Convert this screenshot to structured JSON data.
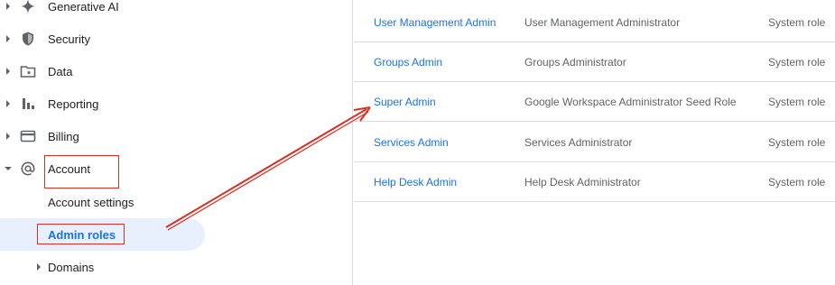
{
  "sidebar": {
    "items": [
      {
        "label": "Generative AI",
        "icon": "sparkle-icon"
      },
      {
        "label": "Security",
        "icon": "shield-icon"
      },
      {
        "label": "Data",
        "icon": "folder-star-icon"
      },
      {
        "label": "Reporting",
        "icon": "bar-chart-icon"
      },
      {
        "label": "Billing",
        "icon": "credit-card-icon"
      },
      {
        "label": "Account",
        "icon": "at-sign-icon"
      }
    ],
    "account_children": [
      {
        "label": "Account settings"
      },
      {
        "label": "Admin roles"
      },
      {
        "label": "Domains"
      }
    ]
  },
  "roles_table": {
    "rows": [
      {
        "name": "User Management Admin",
        "description": "User Management Administrator",
        "type": "System role"
      },
      {
        "name": "Groups Admin",
        "description": "Groups Administrator",
        "type": "System role"
      },
      {
        "name": "Super Admin",
        "description": "Google Workspace Administrator Seed Role",
        "type": "System role"
      },
      {
        "name": "Services Admin",
        "description": "Services Administrator",
        "type": "System role"
      },
      {
        "name": "Help Desk Admin",
        "description": "Help Desk Administrator",
        "type": "System role"
      }
    ]
  },
  "colors": {
    "link": "#1a73e8",
    "annotation_red": "#d93025",
    "selected_bg": "#e8f0fe"
  }
}
